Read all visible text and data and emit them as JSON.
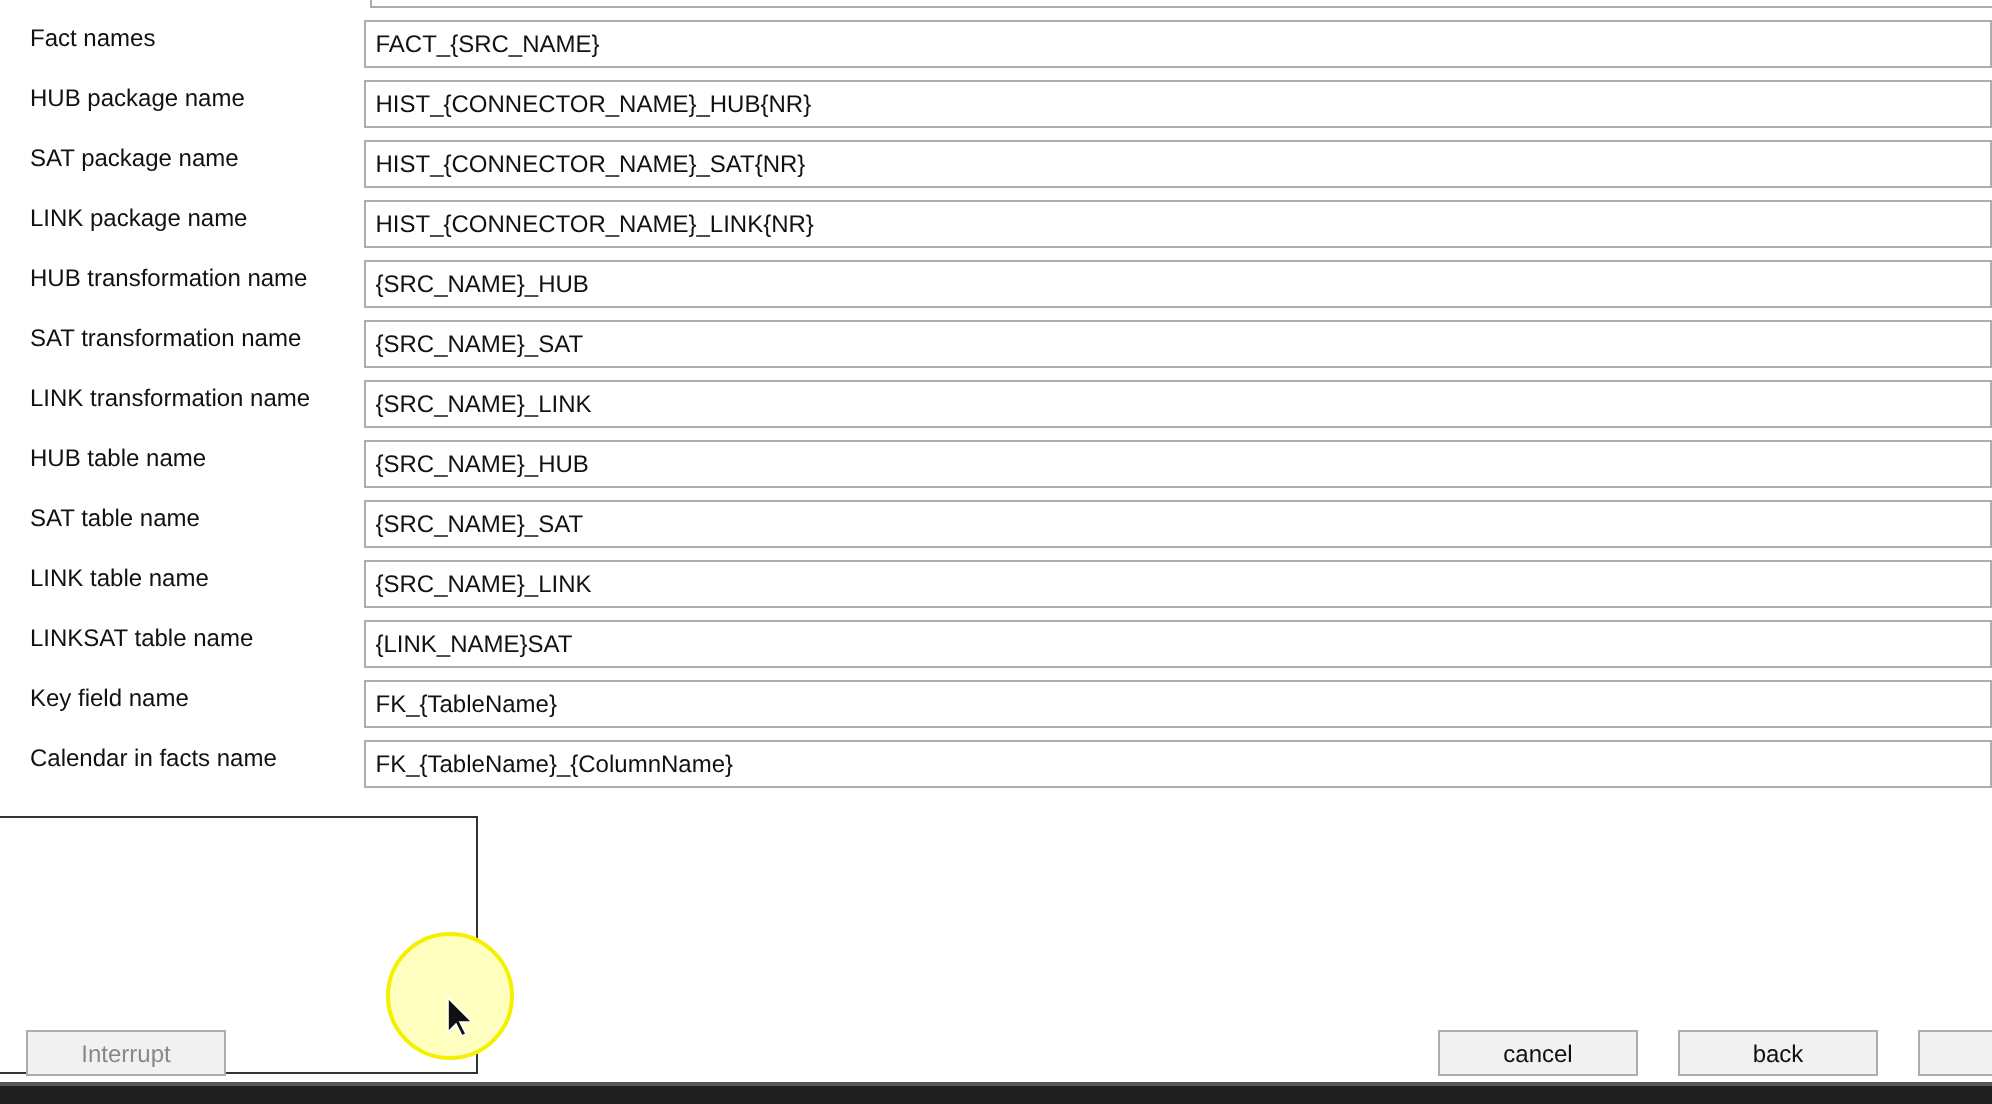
{
  "fields": [
    {
      "label": "Fact names",
      "value": "FACT_{SRC_NAME}"
    },
    {
      "label": "HUB package name",
      "value": "HIST_{CONNECTOR_NAME}_HUB{NR}"
    },
    {
      "label": "SAT package name",
      "value": "HIST_{CONNECTOR_NAME}_SAT{NR}"
    },
    {
      "label": "LINK package name",
      "value": "HIST_{CONNECTOR_NAME}_LINK{NR}"
    },
    {
      "label": "HUB transformation name",
      "value": "{SRC_NAME}_HUB"
    },
    {
      "label": "SAT transformation name",
      "value": "{SRC_NAME}_SAT"
    },
    {
      "label": "LINK transformation name",
      "value": "{SRC_NAME}_LINK"
    },
    {
      "label": "HUB table name",
      "value": "{SRC_NAME}_HUB"
    },
    {
      "label": "SAT table name",
      "value": "{SRC_NAME}_SAT"
    },
    {
      "label": "LINK table name",
      "value": "{SRC_NAME}_LINK"
    },
    {
      "label": "LINKSAT table name",
      "value": "{LINK_NAME}SAT"
    },
    {
      "label": "Key field name",
      "value": "FK_{TableName}"
    },
    {
      "label": "Calendar in facts name",
      "value": "FK_{TableName}_{ColumnName}"
    }
  ],
  "interrupt_button": {
    "label": "Interrupt",
    "disabled": true
  },
  "buttons": [
    {
      "label": "cancel"
    },
    {
      "label": "back"
    }
  ]
}
